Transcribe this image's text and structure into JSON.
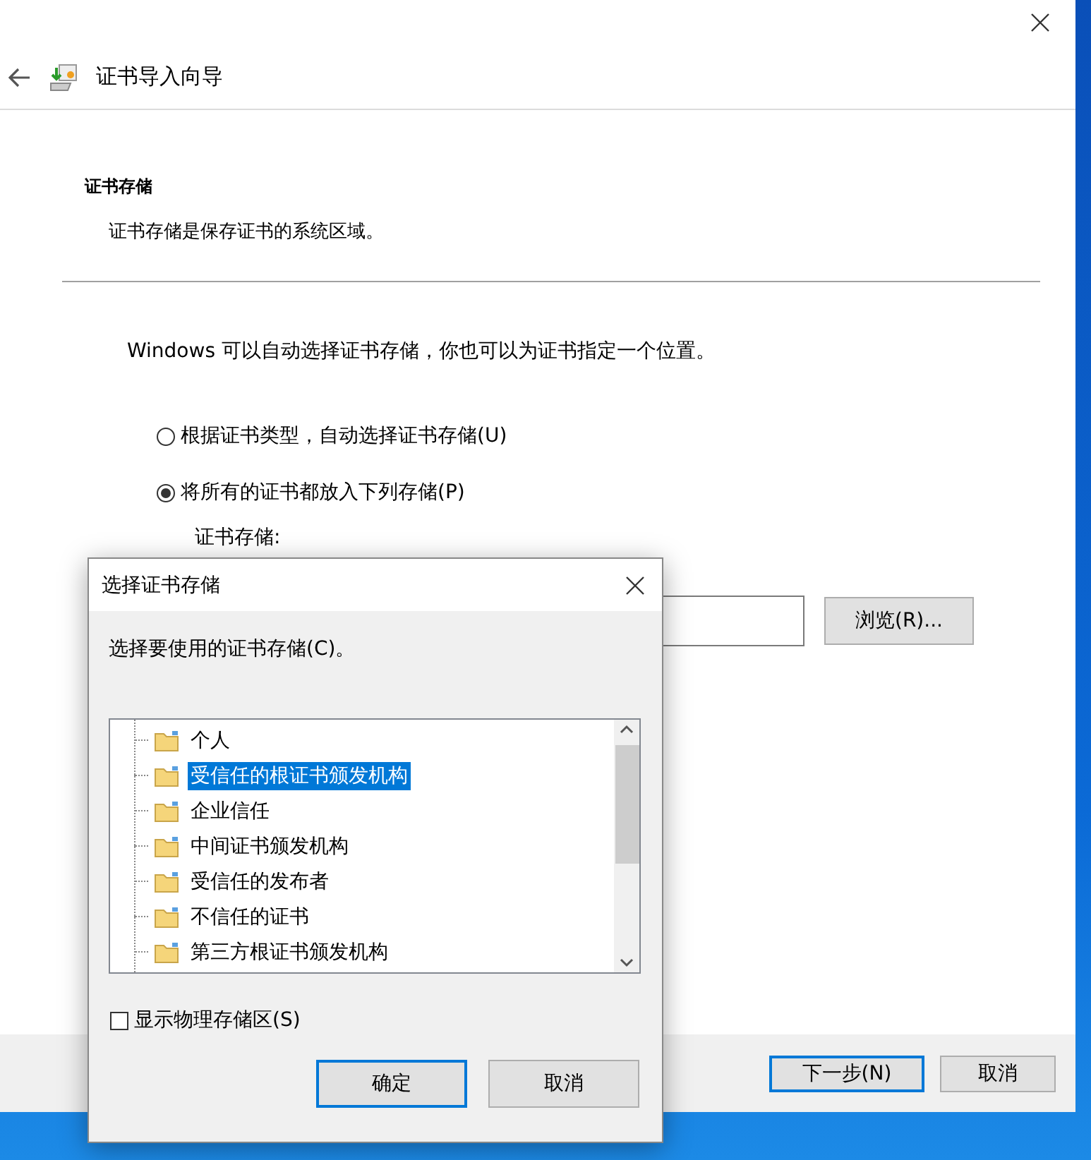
{
  "header": {
    "title": "证书导入向导"
  },
  "section": {
    "title": "证书存储",
    "subtitle": "证书存储是保存证书的系统区域。"
  },
  "intro": "Windows 可以自动选择证书存储，你也可以为证书指定一个位置。",
  "options": [
    {
      "label": "根据证书类型，自动选择证书存储(U)",
      "selected": false
    },
    {
      "label": "将所有的证书都放入下列存储(P)",
      "selected": true
    }
  ],
  "store_field": {
    "label": "证书存储:"
  },
  "browse_button": "浏览(R)...",
  "footer": {
    "buttons": [
      {
        "label": "下一步(N)",
        "default": true
      },
      {
        "label": "取消",
        "default": false
      }
    ]
  },
  "dialog": {
    "title": "选择证书存储",
    "prompt": "选择要使用的证书存储(C)。",
    "tree": [
      {
        "label": "个人",
        "selected": false
      },
      {
        "label": "受信任的根证书颁发机构",
        "selected": true
      },
      {
        "label": "企业信任",
        "selected": false
      },
      {
        "label": "中间证书颁发机构",
        "selected": false
      },
      {
        "label": "受信任的发布者",
        "selected": false
      },
      {
        "label": "不信任的证书",
        "selected": false
      },
      {
        "label": "第三方根证书颁发机构",
        "selected": false
      }
    ],
    "show_physical": {
      "label": "显示物理存储区(S)",
      "checked": false
    },
    "buttons": [
      {
        "label": "确定",
        "default": true
      },
      {
        "label": "取消",
        "default": false
      }
    ]
  }
}
